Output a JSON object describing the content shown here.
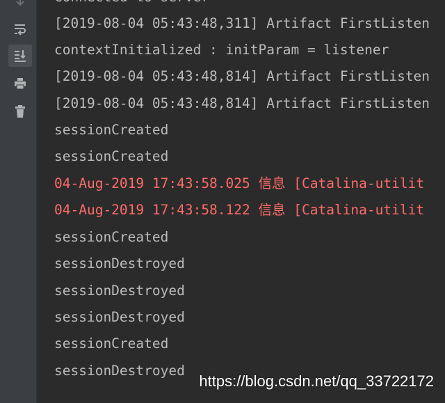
{
  "toolbar": {
    "icons": [
      "scroll-down-icon",
      "soft-wrap-icon",
      "scroll-to-end-icon",
      "print-icon",
      "trash-icon"
    ],
    "active_icon": "scroll-to-end-icon"
  },
  "console": {
    "lines": [
      {
        "text": "Connected to server",
        "type": "stdout"
      },
      {
        "text": "[2019-08-04 05:43:48,311] Artifact FirstListen",
        "type": "stdout"
      },
      {
        "text": "contextInitialized : initParam = listener",
        "type": "stdout"
      },
      {
        "text": "[2019-08-04 05:43:48,814] Artifact FirstListen",
        "type": "stdout"
      },
      {
        "text": "[2019-08-04 05:43:48,814] Artifact FirstListen",
        "type": "stdout"
      },
      {
        "text": "sessionCreated",
        "type": "stdout"
      },
      {
        "text": "sessionCreated",
        "type": "stdout"
      },
      {
        "text": "04-Aug-2019 17:43:58.025 信息 [Catalina-utilit",
        "type": "stderr"
      },
      {
        "text": "04-Aug-2019 17:43:58.122 信息 [Catalina-utilit",
        "type": "stderr"
      },
      {
        "text": "sessionCreated",
        "type": "stdout"
      },
      {
        "text": "sessionDestroyed",
        "type": "stdout"
      },
      {
        "text": "sessionDestroyed",
        "type": "stdout"
      },
      {
        "text": "sessionDestroyed",
        "type": "stdout"
      },
      {
        "text": "sessionCreated",
        "type": "stdout"
      },
      {
        "text": "sessionDestroyed",
        "type": "stdout"
      }
    ]
  },
  "watermark": "https://blog.csdn.net/qq_33722172",
  "colors": {
    "background": "#2b2b2b",
    "toolbar": "#3c3f41",
    "stdout": "#bbbbbb",
    "stderr": "#ff6b68",
    "icon": "#afb1b3"
  }
}
